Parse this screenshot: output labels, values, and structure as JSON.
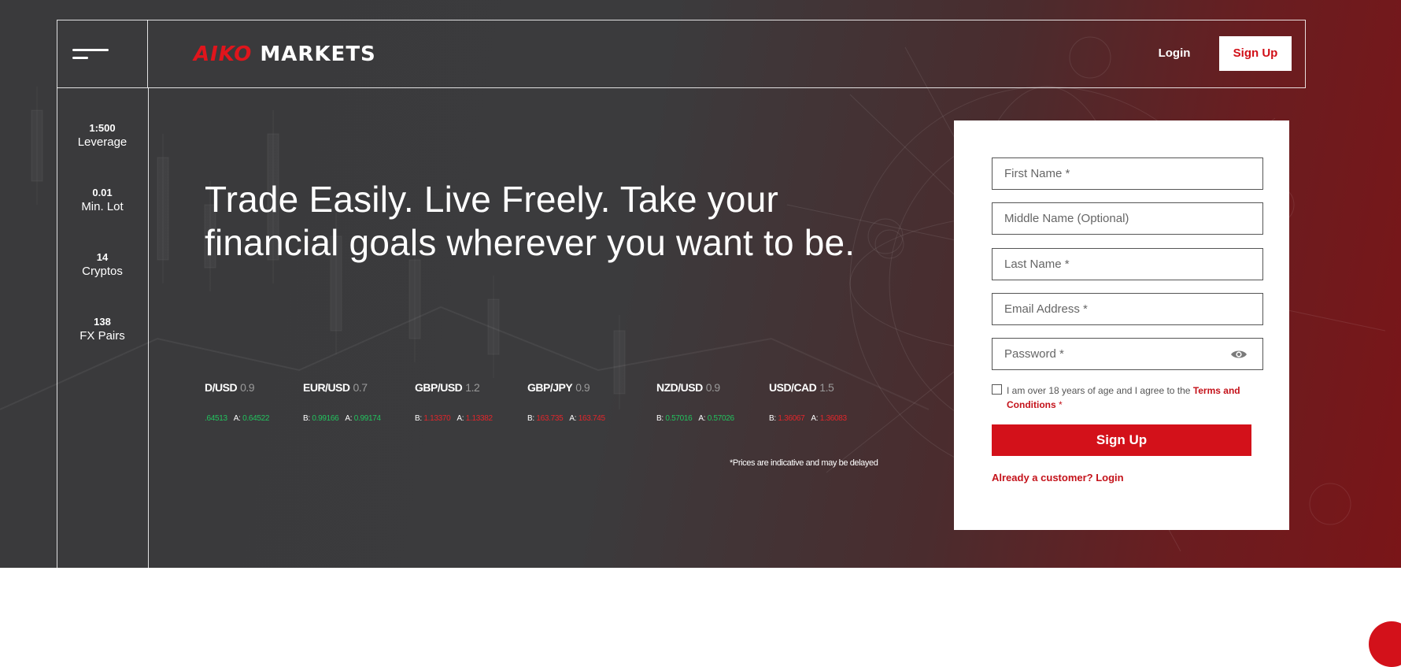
{
  "header": {
    "logo_part1": "AIKO",
    "logo_part2": "MARKETS",
    "login_label": "Login",
    "signup_label": "Sign Up",
    "menu_icon": "hamburger-menu-icon"
  },
  "stats": [
    {
      "value": "1:500",
      "label": "Leverage"
    },
    {
      "value": "0.01",
      "label": "Min. Lot"
    },
    {
      "value": "14",
      "label": "Cryptos"
    },
    {
      "value": "138",
      "label": "FX Pairs"
    }
  ],
  "hero": {
    "headline": "Trade Easily. Live Freely. Take your financial goals wherever you want to be."
  },
  "ticker": [
    {
      "pair": "D/USD",
      "spread": "0.9",
      "bid_prefix": "",
      "bid": ".64513",
      "ask_prefix": "A:",
      "ask": "0.64522",
      "trend": "up"
    },
    {
      "pair": "EUR/USD",
      "spread": "0.7",
      "bid_prefix": "B:",
      "bid": "0.99166",
      "ask_prefix": "A:",
      "ask": "0.99174",
      "trend": "up"
    },
    {
      "pair": "GBP/USD",
      "spread": "1.2",
      "bid_prefix": "B:",
      "bid": "1.13370",
      "ask_prefix": "A:",
      "ask": "1.13382",
      "trend": "down"
    },
    {
      "pair": "GBP/JPY",
      "spread": "0.9",
      "bid_prefix": "B:",
      "bid": "163.735",
      "ask_prefix": "A:",
      "ask": "163.745",
      "trend": "down"
    },
    {
      "pair": "NZD/USD",
      "spread": "0.9",
      "bid_prefix": "B:",
      "bid": "0.57016",
      "ask_prefix": "A:",
      "ask": "0.57026",
      "trend": "up"
    },
    {
      "pair": "USD/CAD",
      "spread": "1.5",
      "bid_prefix": "B:",
      "bid": "1.36067",
      "ask_prefix": "A:",
      "ask": "1.36083",
      "trend": "down"
    }
  ],
  "disclaimer": "*Prices are indicative and may be delayed",
  "form": {
    "first_name_placeholder": "First Name *",
    "middle_name_placeholder": "Middle Name (Optional)",
    "last_name_placeholder": "Last Name *",
    "email_placeholder": "Email Address *",
    "password_placeholder": "Password *",
    "password_toggle_icon": "eye-icon",
    "terms_text": "I am over 18 years of age and I agree to the ",
    "terms_link": "Terms and Conditions",
    "terms_required": " *",
    "signup_label": "Sign Up",
    "already_customer": "Already a customer? Login"
  },
  "colors": {
    "brand_red": "#d3111a",
    "bid_up": "#22c35e",
    "bid_down": "#e3262b"
  }
}
